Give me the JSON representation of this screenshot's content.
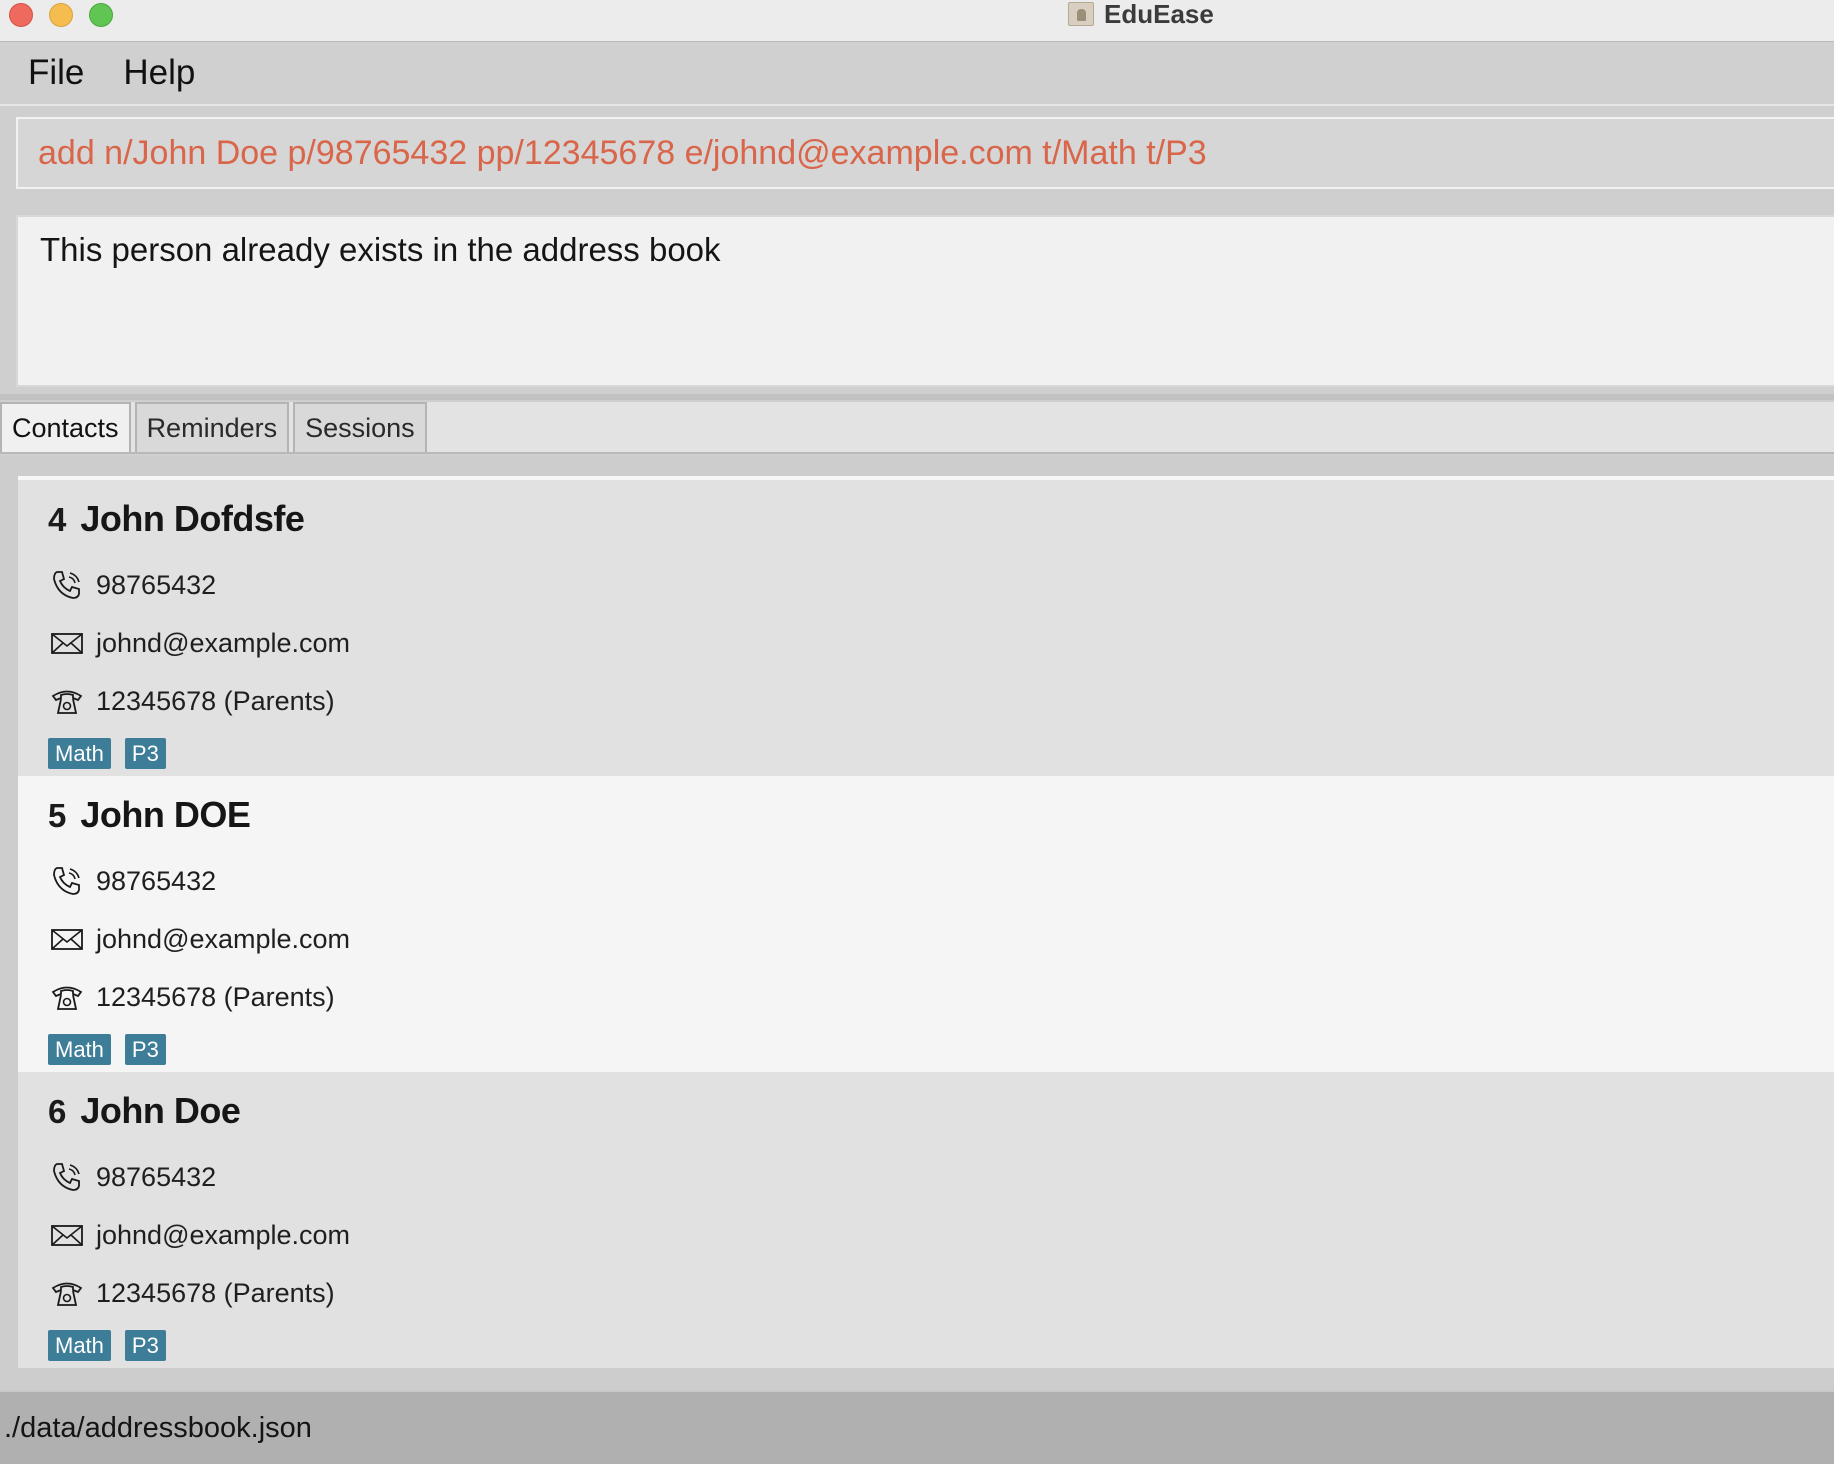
{
  "window": {
    "title": "EduEase"
  },
  "menu": {
    "items": [
      "File",
      "Help"
    ]
  },
  "command": {
    "value": "add n/John Doe p/98765432 pp/12345678 e/johnd@example.com t/Math t/P3"
  },
  "result": {
    "message": "This person already exists in the address book"
  },
  "tabs": [
    {
      "label": "Contacts",
      "active": true
    },
    {
      "label": "Reminders",
      "active": false
    },
    {
      "label": "Sessions",
      "active": false
    }
  ],
  "contacts": [
    {
      "index": "4",
      "name": "John Dofdsfe",
      "phone": "98765432",
      "email": "johnd@example.com",
      "parent_phone": "12345678 (Parents)",
      "tags": [
        "Math",
        "P3"
      ]
    },
    {
      "index": "5",
      "name": "John DOE",
      "phone": "98765432",
      "email": "johnd@example.com",
      "parent_phone": "12345678 (Parents)",
      "tags": [
        "Math",
        "P3"
      ]
    },
    {
      "index": "6",
      "name": "John Doe",
      "phone": "98765432",
      "email": "johnd@example.com",
      "parent_phone": "12345678 (Parents)",
      "tags": [
        "Math",
        "P3"
      ]
    }
  ],
  "status": {
    "path": "./data/addressbook.json"
  },
  "colors": {
    "command_text": "#d9664a",
    "tag_bg": "#3e7d98"
  }
}
